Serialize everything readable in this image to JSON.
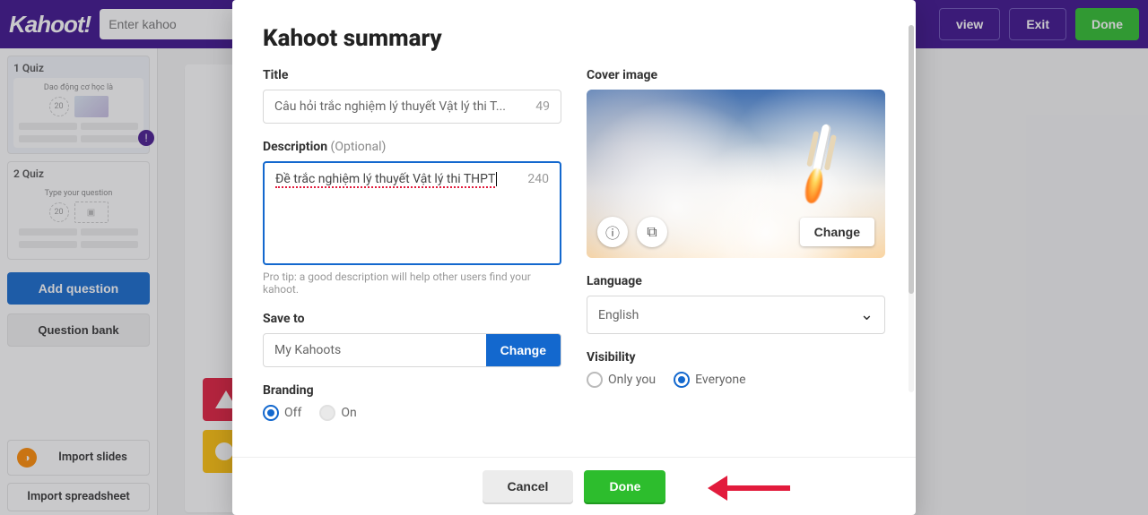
{
  "topbar": {
    "logo_text": "Kahoot!",
    "title_placeholder": "Enter kahoo",
    "preview": "view",
    "exit": "Exit",
    "done": "Done"
  },
  "left": {
    "slides": [
      {
        "index_label": "1  Quiz",
        "question_preview": "Dao động cơ học là",
        "timer": "20",
        "has_image": true,
        "has_warning": true
      },
      {
        "index_label": "2  Quiz",
        "question_preview": "Type your question",
        "timer": "20",
        "has_image": false,
        "has_warning": false
      }
    ],
    "add_question": "Add question",
    "question_bank": "Question bank",
    "import_slides": "Import slides",
    "import_spreadsheet": "Import spreadsheet"
  },
  "modal": {
    "heading": "Kahoot summary",
    "title_label": "Title",
    "title_value": "Câu hỏi trắc nghiệm lý thuyết Vật lý thi T...",
    "title_count": "49",
    "desc_label": "Description",
    "desc_optional": "(Optional)",
    "desc_value": "Đề trắc nghiệm lý thuyết Vật lý thi THPT",
    "desc_count": "240",
    "desc_tip": "Pro tip: a good description will help other users find your kahoot.",
    "saveto_label": "Save to",
    "saveto_value": "My Kahoots",
    "saveto_change": "Change",
    "cover_label": "Cover image",
    "cover_change": "Change",
    "language_label": "Language",
    "language_value": "English",
    "branding_label": "Branding",
    "branding_off": "Off",
    "branding_on": "On",
    "visibility_label": "Visibility",
    "visibility_only_you": "Only you",
    "visibility_everyone": "Everyone",
    "cancel": "Cancel",
    "done": "Done"
  }
}
